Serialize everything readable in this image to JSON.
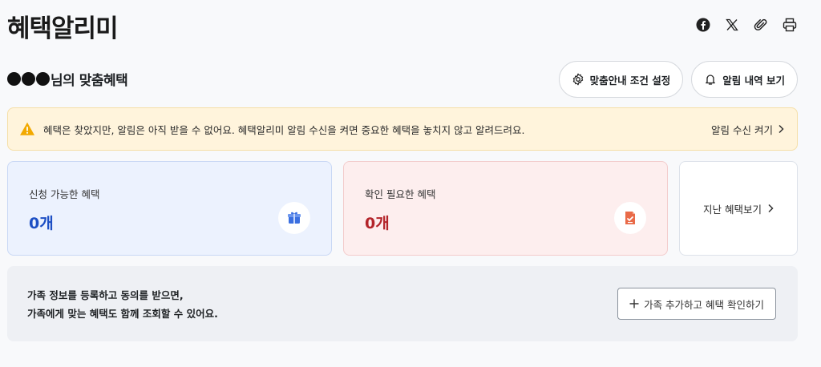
{
  "page": {
    "title": "혜택알리미"
  },
  "share": {
    "icons": [
      "facebook-icon",
      "x-icon",
      "link-icon",
      "print-icon"
    ]
  },
  "header": {
    "user_suffix": "님의 맞춤혜택",
    "settings_button": "맞춤안내 조건 설정",
    "history_button": "알림 내역 보기"
  },
  "alert": {
    "message": "혜택은 찾았지만, 알림은 아직 받을 수 없어요. 혜택알리미 알림 수신을 켜면 중요한 혜택을 놓치지 않고 알려드려요.",
    "link_label": "알림 수신 켜기"
  },
  "cards": {
    "available": {
      "label": "신청 가능한 혜택",
      "count": "0개"
    },
    "needs_check": {
      "label": "확인 필요한 혜택",
      "count": "0개"
    },
    "past_label": "지난 혜택보기"
  },
  "family": {
    "line1": "가족 정보를 등록하고 동의를 받으면,",
    "line2": "가족에게 맞는 혜택도 함께 조회할 수 있어요.",
    "button_label": "가족 추가하고 혜택 확인하기"
  },
  "colors": {
    "accent_blue": "#1d4fc4",
    "accent_red": "#b3242a",
    "alert_bg": "#fff4dc",
    "warning": "#f2a900"
  }
}
